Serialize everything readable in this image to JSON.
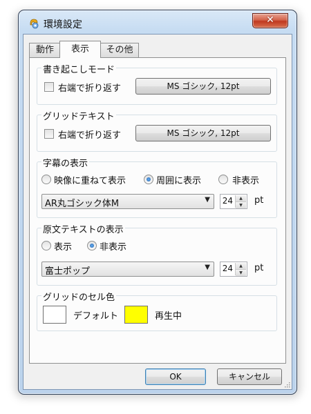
{
  "window": {
    "title": "環境設定",
    "close_icon": "close-icon"
  },
  "tabs": [
    {
      "label": "動作",
      "active": false
    },
    {
      "label": "表示",
      "active": true
    },
    {
      "label": "その他",
      "active": false
    }
  ],
  "groups": {
    "transcription_mode": {
      "title": "書き起こしモード",
      "wrap_label": "右端で折り返す",
      "wrap_checked": false,
      "font_button": "MS ゴシック, 12pt"
    },
    "grid_text": {
      "title": "グリッドテキスト",
      "wrap_label": "右端で折り返す",
      "wrap_checked": false,
      "font_button": "MS ゴシック, 12pt"
    },
    "subtitle_display": {
      "title": "字幕の表示",
      "radio_options": [
        "映像に重ねて表示",
        "周囲に表示",
        "非表示"
      ],
      "selected": "周囲に表示",
      "font_select": "AR丸ゴシック体M",
      "size_value": "24",
      "size_unit": "pt"
    },
    "source_text_display": {
      "title": "原文テキストの表示",
      "radio_options": [
        "表示",
        "非表示"
      ],
      "selected": "非表示",
      "font_select": "富士ポップ",
      "size_value": "24",
      "size_unit": "pt"
    },
    "grid_cell_color": {
      "title": "グリッドのセル色",
      "default_label": "デフォルト",
      "playing_label": "再生中",
      "default_color": "#ffffff",
      "playing_color": "#ffff00"
    }
  },
  "footer": {
    "ok_label": "OK",
    "cancel_label": "キャンセル"
  },
  "colors": {
    "close_button": "#c7432a",
    "frame": "#bcd3ec",
    "focus_border": "#3c7fb1"
  }
}
